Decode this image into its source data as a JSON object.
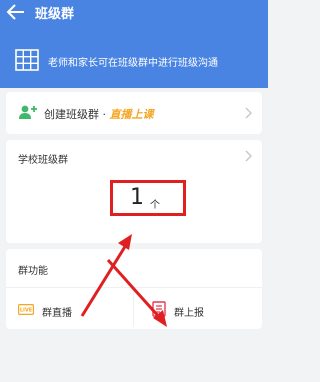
{
  "header": {
    "title": "班级群",
    "subtitle": "老师和家长可在班级群中进行班级沟通"
  },
  "create_group": {
    "label": "创建班级群",
    "separator": "·",
    "highlight": "直播上课"
  },
  "school_groups": {
    "label": "学校班级群",
    "count": "1",
    "unit": "个"
  },
  "functions": {
    "title": "群功能",
    "items": [
      {
        "label": "群直播",
        "icon": "live-icon",
        "icon_text": "LIVE"
      },
      {
        "label": "群上报",
        "icon": "report-icon"
      }
    ]
  },
  "colors": {
    "header": "#4a84e3",
    "accent_text": "#f5a623",
    "annotation": "#e02020",
    "add_user_icon": "#3fb86b"
  }
}
